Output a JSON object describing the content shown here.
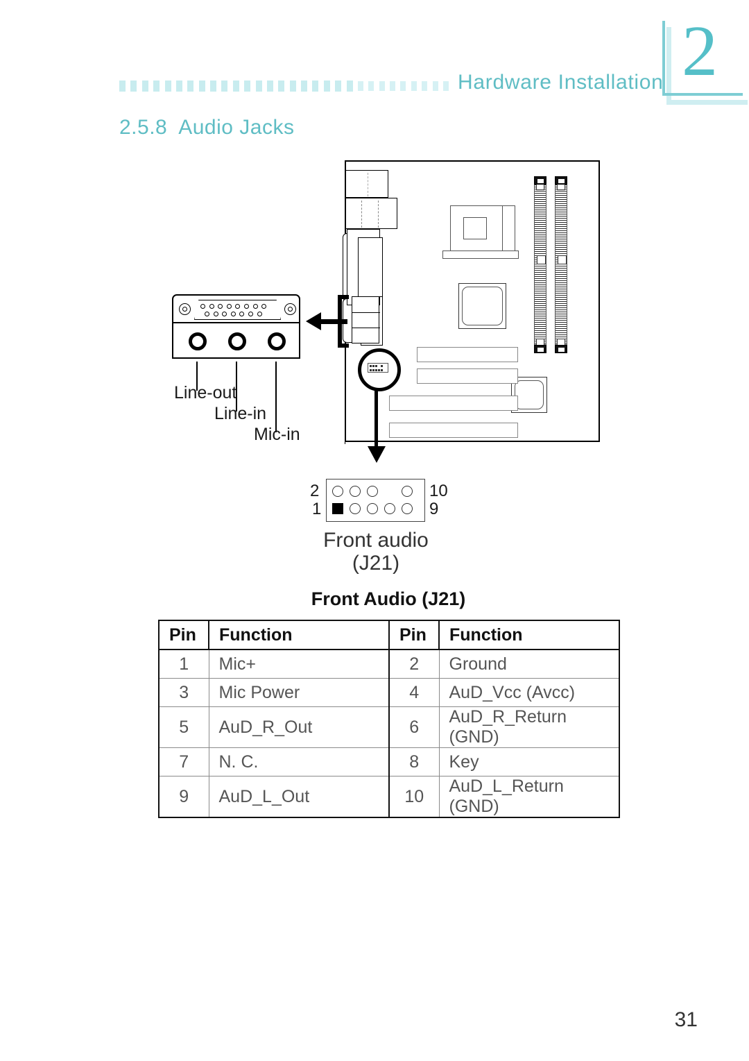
{
  "header": {
    "title": "Hardware Installation",
    "chapter_number": "2",
    "dot_count": 30
  },
  "section": {
    "number": "2.5.8",
    "title": "Audio Jacks"
  },
  "figure": {
    "jack_labels": {
      "line_out": "Line-out",
      "line_in": "Line-in",
      "mic_in": "Mic-in"
    },
    "pin_header": {
      "top_left_num": "2",
      "bottom_left_num": "1",
      "top_right_num": "10",
      "bottom_right_num": "9",
      "caption_line1": "Front audio",
      "caption_line2": "(J21)",
      "top_row": [
        "pin",
        "pin",
        "pin",
        "gap",
        "pin"
      ],
      "bottom_row": [
        "filled",
        "pin",
        "pin",
        "pin",
        "pin"
      ]
    },
    "motherboard": {
      "dimm_slots": 2,
      "pci_slots": 3
    }
  },
  "table": {
    "title": "Front Audio (J21)",
    "headers": [
      "Pin",
      "Function",
      "Pin",
      "Function"
    ],
    "rows": [
      [
        "1",
        "Mic+",
        "2",
        "Ground"
      ],
      [
        "3",
        "Mic Power",
        "4",
        "AuD_Vcc (Avcc)"
      ],
      [
        "5",
        "AuD_R_Out",
        "6",
        "AuD_R_Return (GND)"
      ],
      [
        "7",
        "N. C.",
        "8",
        "Key"
      ],
      [
        "9",
        "AuD_L_Out",
        "10",
        "AuD_L_Return (GND)"
      ]
    ]
  },
  "footer": {
    "page_number": "31"
  },
  "colors": {
    "accent_teal": "#5fbdc4",
    "dot_teal": "#c8ecef",
    "bracket_shadow": "#cfeef1",
    "ink": "#000000"
  }
}
